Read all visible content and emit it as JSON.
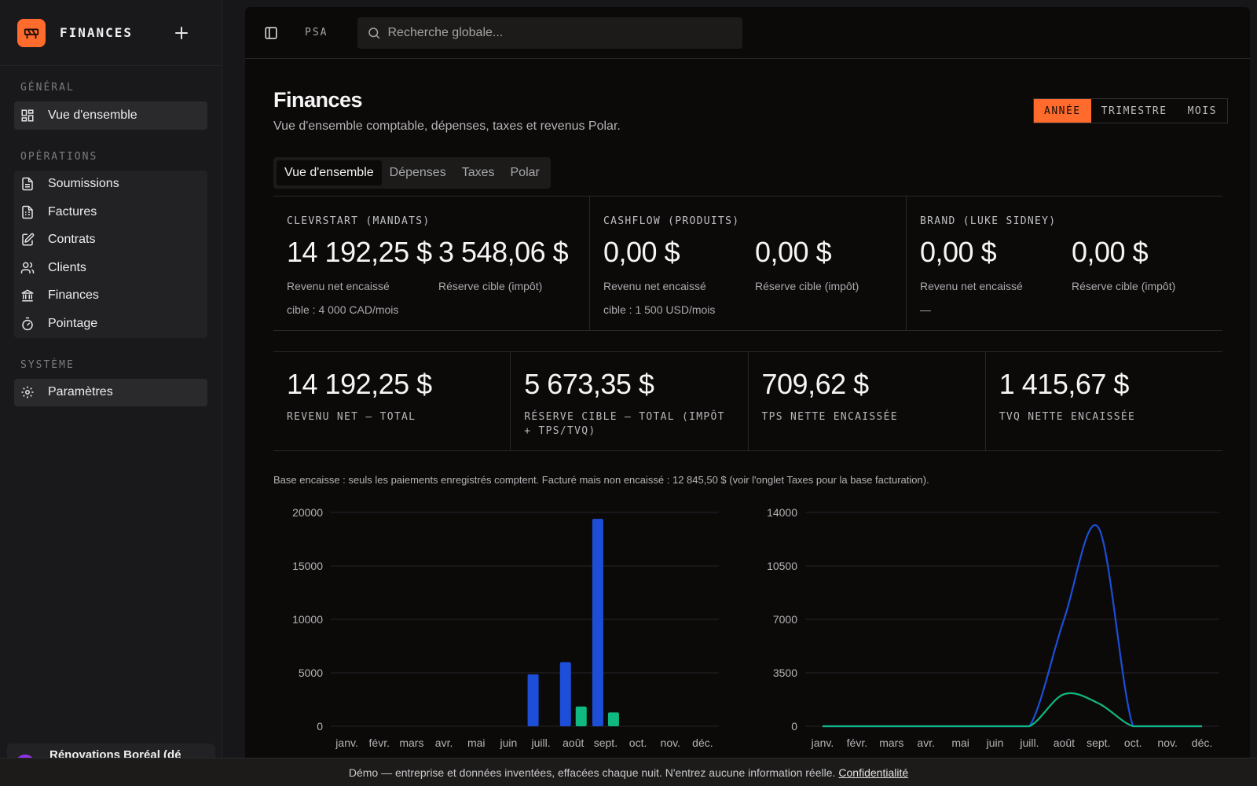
{
  "sidebar": {
    "brand": "FINANCES",
    "sections": [
      {
        "label": "GÉNÉRAL",
        "items": [
          {
            "label": "Vue d'ensemble",
            "icon": "grid-icon"
          }
        ]
      },
      {
        "label": "OPÉRATIONS",
        "items": [
          {
            "label": "Soumissions",
            "icon": "document-icon"
          },
          {
            "label": "Factures",
            "icon": "invoice-icon"
          },
          {
            "label": "Contrats",
            "icon": "contract-icon"
          },
          {
            "label": "Clients",
            "icon": "users-icon"
          },
          {
            "label": "Finances",
            "icon": "bank-icon"
          },
          {
            "label": "Pointage",
            "icon": "stopwatch-icon"
          }
        ]
      },
      {
        "label": "SYSTÈME",
        "items": [
          {
            "label": "Paramètres",
            "icon": "gear-icon"
          }
        ]
      }
    ],
    "org": "Rénovations Boréal (dé"
  },
  "topbar": {
    "crumb": "PSA",
    "search_placeholder": "Recherche globale..."
  },
  "page": {
    "title": "Finances",
    "subtitle": "Vue d'ensemble comptable, dépenses, taxes et revenus Polar.",
    "periods": [
      "ANNÉE",
      "TRIMESTRE",
      "MOIS"
    ],
    "active_period": "ANNÉE",
    "tabs": [
      "Vue d'ensemble",
      "Dépenses",
      "Taxes",
      "Polar"
    ],
    "active_tab": "Vue d'ensemble"
  },
  "brands": [
    {
      "label": "CLEVRSTART (MANDATS)",
      "revenue": "14 192,25 $",
      "revenue_caption": "Revenu net encaissé",
      "reserve": "3 548,06 $",
      "reserve_caption": "Réserve cible (impôt)",
      "target": "cible : 4 000 CAD/mois"
    },
    {
      "label": "CASHFLOW (PRODUITS)",
      "revenue": "0,00 $",
      "revenue_caption": "Revenu net encaissé",
      "reserve": "0,00 $",
      "reserve_caption": "Réserve cible (impôt)",
      "target": "cible : 1 500 USD/mois"
    },
    {
      "label": "BRAND (LUKE SIDNEY)",
      "revenue": "0,00 $",
      "revenue_caption": "Revenu net encaissé",
      "reserve": "0,00 $",
      "reserve_caption": "Réserve cible (impôt)",
      "target": "—"
    }
  ],
  "totals": [
    {
      "value": "14 192,25 $",
      "caption": "REVENU NET — TOTAL"
    },
    {
      "value": "5 673,35 $",
      "caption": "RÉSERVE CIBLE — TOTAL (IMPÔT + TPS/TVQ)"
    },
    {
      "value": "709,62 $",
      "caption": "TPS NETTE ENCAISSÉE"
    },
    {
      "value": "1 415,67 $",
      "caption": "TVQ NETTE ENCAISSÉE"
    }
  ],
  "note": "Base encaisse : seuls les paiements enregistrés comptent. Facturé mais non encaissé : 12 845,50 $ (voir l'onglet Taxes pour la base facturation).",
  "footer": {
    "text": "Démo — entreprise et données inventées, effacées chaque nuit. N'entrez aucune information réelle.",
    "link": "Confidentialité"
  },
  "chart_data": [
    {
      "type": "bar",
      "categories": [
        "janv.",
        "févr.",
        "mars",
        "avr.",
        "mai",
        "juin",
        "juill.",
        "août",
        "sept.",
        "oct.",
        "nov.",
        "déc."
      ],
      "yticks": [
        0,
        5000,
        10000,
        15000,
        20000
      ],
      "ylim": [
        0,
        20000
      ],
      "grid": true,
      "series": [
        {
          "color": "#1d4ed8",
          "values": [
            0,
            0,
            0,
            0,
            0,
            0,
            4850,
            6000,
            19400,
            0,
            0,
            0
          ]
        },
        {
          "color": "#10b981",
          "values": [
            0,
            0,
            0,
            0,
            0,
            0,
            0,
            1850,
            1300,
            0,
            0,
            0
          ]
        }
      ]
    },
    {
      "type": "line",
      "categories": [
        "janv.",
        "févr.",
        "mars",
        "avr.",
        "mai",
        "juin",
        "juill.",
        "août",
        "sept.",
        "oct.",
        "nov.",
        "déc."
      ],
      "yticks": [
        0,
        3500,
        7000,
        10500,
        14000
      ],
      "ylim": [
        0,
        14000
      ],
      "grid": true,
      "series": [
        {
          "color": "#1d4ed8",
          "values": [
            0,
            0,
            0,
            0,
            0,
            0,
            0,
            7000,
            13000,
            0,
            0,
            0
          ]
        },
        {
          "color": "#10b981",
          "values": [
            0,
            0,
            0,
            0,
            0,
            0,
            0,
            2100,
            1500,
            0,
            0,
            0
          ]
        }
      ]
    }
  ]
}
